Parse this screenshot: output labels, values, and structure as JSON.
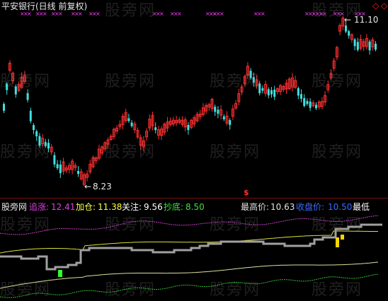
{
  "title": "平安银行(日线 前复权)",
  "watermark": "股旁网",
  "price_panel": {
    "price_high_label": "11.10",
    "price_low_label": "8.23",
    "signal_marker": "$"
  },
  "indicator_bar": {
    "source_label": "股旁网",
    "items": [
      {
        "label": "追涨:",
        "value": "12.41",
        "color": "#e040e0"
      },
      {
        "label": "加仓:",
        "value": "11.38",
        "color": "#ffff40"
      },
      {
        "label": "关注:",
        "value": "9.56",
        "color": "#ffffff"
      },
      {
        "label": "抄底:",
        "value": "8.50",
        "color": "#40e040"
      }
    ],
    "right_items": [
      {
        "label": "最高价:",
        "value": "10.63",
        "color": "#e0e0e0"
      },
      {
        "label": "收盘价:",
        "value": "10.50",
        "color": "#3a6bff"
      },
      {
        "label": "最低",
        "value": "",
        "color": "#ffffff"
      }
    ]
  },
  "colors": {
    "background": "#000000",
    "up_candle": "#ff3030",
    "down_candle": "#40e0e0",
    "top_line": "#c040c0",
    "upper_band": "#e0e040",
    "lower_band": "#e0e0a0",
    "bottom_line": "#30c030",
    "step_line": "#a0a0a0"
  }
}
